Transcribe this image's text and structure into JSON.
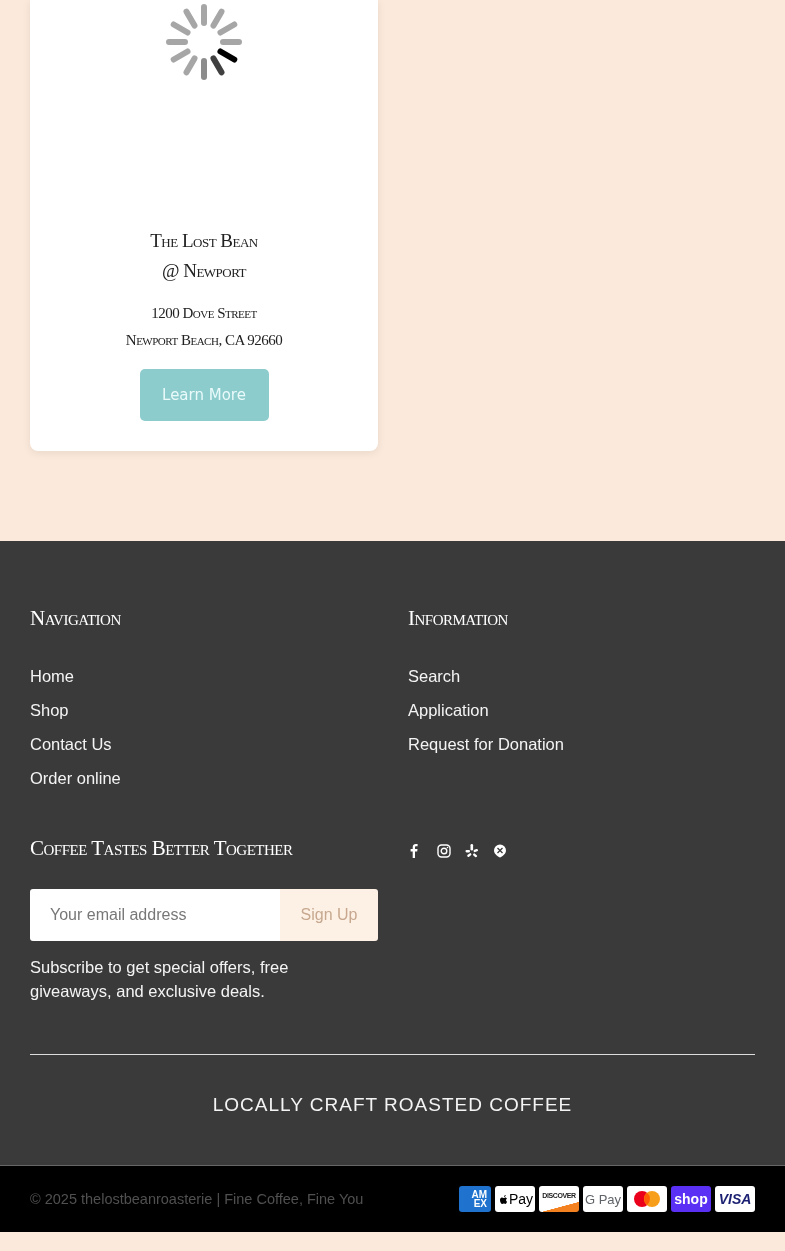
{
  "location_card": {
    "title_lines": [
      "The Lost Bean",
      "@ Newport"
    ],
    "address_lines": [
      "1200 Dove Street",
      "Newport Beach, CA 92660"
    ],
    "button": "Learn More"
  },
  "footer": {
    "columns": [
      {
        "heading": "Navigation",
        "links": [
          "Home",
          "Shop",
          "Contact Us",
          "Order online"
        ]
      },
      {
        "heading": "Information",
        "links": [
          "Search",
          "Application",
          "Request for Donation"
        ]
      }
    ],
    "newsletter": {
      "heading": "Coffee Tastes Better Together",
      "email": {
        "placeholder": "Your email address"
      },
      "button": "Sign Up",
      "note": "Subscribe to get special offers, free giveaways, and exclusive deals."
    },
    "social": [
      {
        "kind": "facebook"
      },
      {
        "kind": "instagram"
      },
      {
        "kind": "yelp"
      },
      {
        "kind": "pin"
      }
    ],
    "tagline": "LOCALLY CRAFT ROASTED COFFEE"
  },
  "bottom_bar": {
    "copyright": "© 2025 thelostbeanroasterie | Fine Coffee, Fine You",
    "payments": [
      {
        "kind": "amex",
        "label": "AM EX"
      },
      {
        "kind": "applepay",
        "label": "Pay"
      },
      {
        "kind": "discover",
        "label": "DISCOVER"
      },
      {
        "kind": "googlepay",
        "label": "G Pay"
      },
      {
        "kind": "mastercard"
      },
      {
        "kind": "shoppay",
        "label": "shop"
      },
      {
        "kind": "visa",
        "label": "VISA"
      }
    ]
  }
}
